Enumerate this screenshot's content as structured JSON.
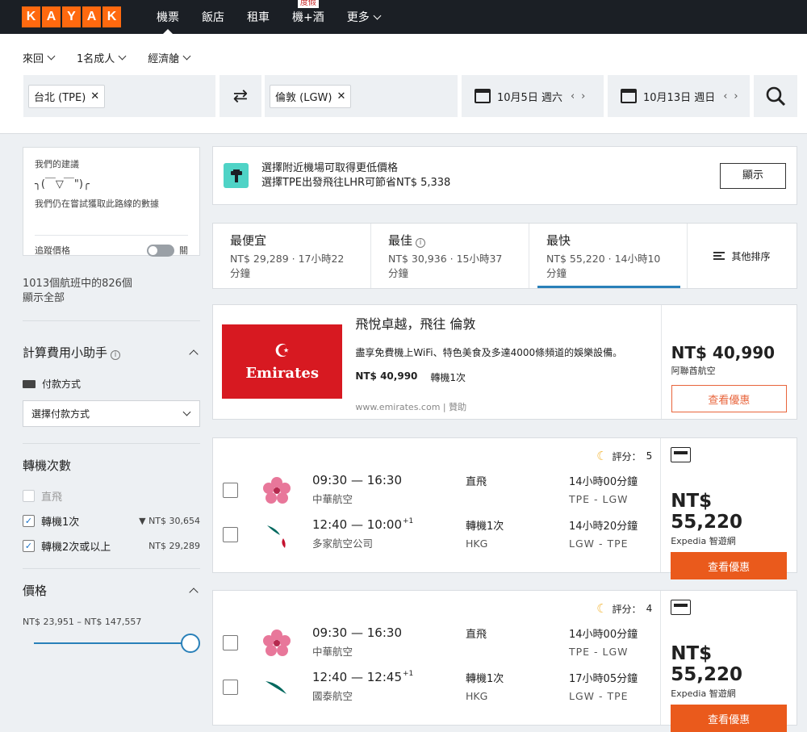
{
  "logo_letters": [
    "K",
    "A",
    "Y",
    "A",
    "K"
  ],
  "logo_colors": [
    "#ff690f",
    "#ff690f",
    "#ff690f",
    "#ff690f",
    "#ff690f"
  ],
  "nav": [
    {
      "label": "機票",
      "active": true
    },
    {
      "label": "飯店",
      "active": false
    },
    {
      "label": "租車",
      "active": false
    },
    {
      "label": "機+酒",
      "badge": "度假",
      "active": false
    },
    {
      "label": "更多",
      "active": false
    }
  ],
  "search": {
    "trip_type": "來回",
    "passengers": "1名成人",
    "cabin": "經濟艙",
    "origin": "台北 (TPE)",
    "destination": "倫敦 (LGW)",
    "depart_date": "10月5日 週六",
    "return_date": "10月13日 週日"
  },
  "sidebar": {
    "advice_title": "我們的建議",
    "advice_face": "╮(￣▽￣\")╭",
    "advice_msg": "我們仍在嘗試獲取此路線的數據",
    "track_label": "追蹤價格",
    "toggle_state": "關",
    "count_line1": "1013個航班中的826個",
    "count_line2": "顯示全部",
    "calc_title": "計算費用小助手",
    "pay_label": "付款方式",
    "pay_select": "選擇付款方式",
    "stops_title": "轉機次數",
    "stops": [
      {
        "label": "直飛",
        "checked": false,
        "disabled": true,
        "price": ""
      },
      {
        "label": "轉機1次",
        "checked": true,
        "disabled": false,
        "price": "NT$ 30,654"
      },
      {
        "label": "轉機2次或以上",
        "checked": true,
        "disabled": false,
        "price": "NT$ 29,289"
      }
    ],
    "price_title": "價格",
    "price_range": "NT$ 23,951 – NT$ 147,557"
  },
  "notice": {
    "line1": "選擇附近機場可取得更低價格",
    "line2": "選擇TPE出發飛往LHR可節省NT$ 5,338",
    "button": "顯示"
  },
  "sort": [
    {
      "title": "最便宜",
      "line1": "NT$ 29,289 · 17小時22",
      "line2": "分鐘",
      "active": false
    },
    {
      "title": "最佳",
      "line1": "NT$ 30,936 · 15小時37",
      "line2": "分鐘",
      "active": false
    },
    {
      "title": "最快",
      "line1": "NT$ 55,220 · 14小時10",
      "line2": "分鐘",
      "active": true
    }
  ],
  "sort_more": "其他排序",
  "ad": {
    "title": "飛悅卓越，飛往 倫敦",
    "desc": "盡享免費機上WiFi、特色美食及多達4000條頻道的娛樂設備。",
    "price": "NT$ 40,990",
    "stops": "轉機1次",
    "url": "www.emirates.com | 贊助",
    "logo_text": "Emirates",
    "big_price": "NT$ 40,990",
    "provider": "阿聯酋航空",
    "button": "查看優惠"
  },
  "results": [
    {
      "rating_label": "評分：",
      "rating": "5",
      "legs": [
        {
          "time": "09:30 — 16:30",
          "sup": "",
          "airline": "中華航空",
          "stops": "直飛",
          "via": "",
          "duration": "14小時00分鐘",
          "route": "TPE - LGW"
        },
        {
          "time": "12:40 — 10:00",
          "sup": "+1",
          "airline": "多家航空公司",
          "stops": "轉機1次",
          "via": "HKG",
          "duration": "14小時20分鐘",
          "route": "LGW - TPE"
        }
      ],
      "price": "NT$ 55,220",
      "provider": "Expedia 智遊網",
      "button": "查看優惠"
    },
    {
      "rating_label": "評分：",
      "rating": "4",
      "legs": [
        {
          "time": "09:30 — 16:30",
          "sup": "",
          "airline": "中華航空",
          "stops": "直飛",
          "via": "",
          "duration": "14小時00分鐘",
          "route": "TPE - LGW"
        },
        {
          "time": "12:40 — 12:45",
          "sup": "+1",
          "airline": "國泰航空",
          "stops": "轉機1次",
          "via": "HKG",
          "duration": "17小時05分鐘",
          "route": "LGW - TPE"
        }
      ],
      "price": "NT$ 55,220",
      "provider": "Expedia 智遊網",
      "button": "查看優惠"
    }
  ]
}
